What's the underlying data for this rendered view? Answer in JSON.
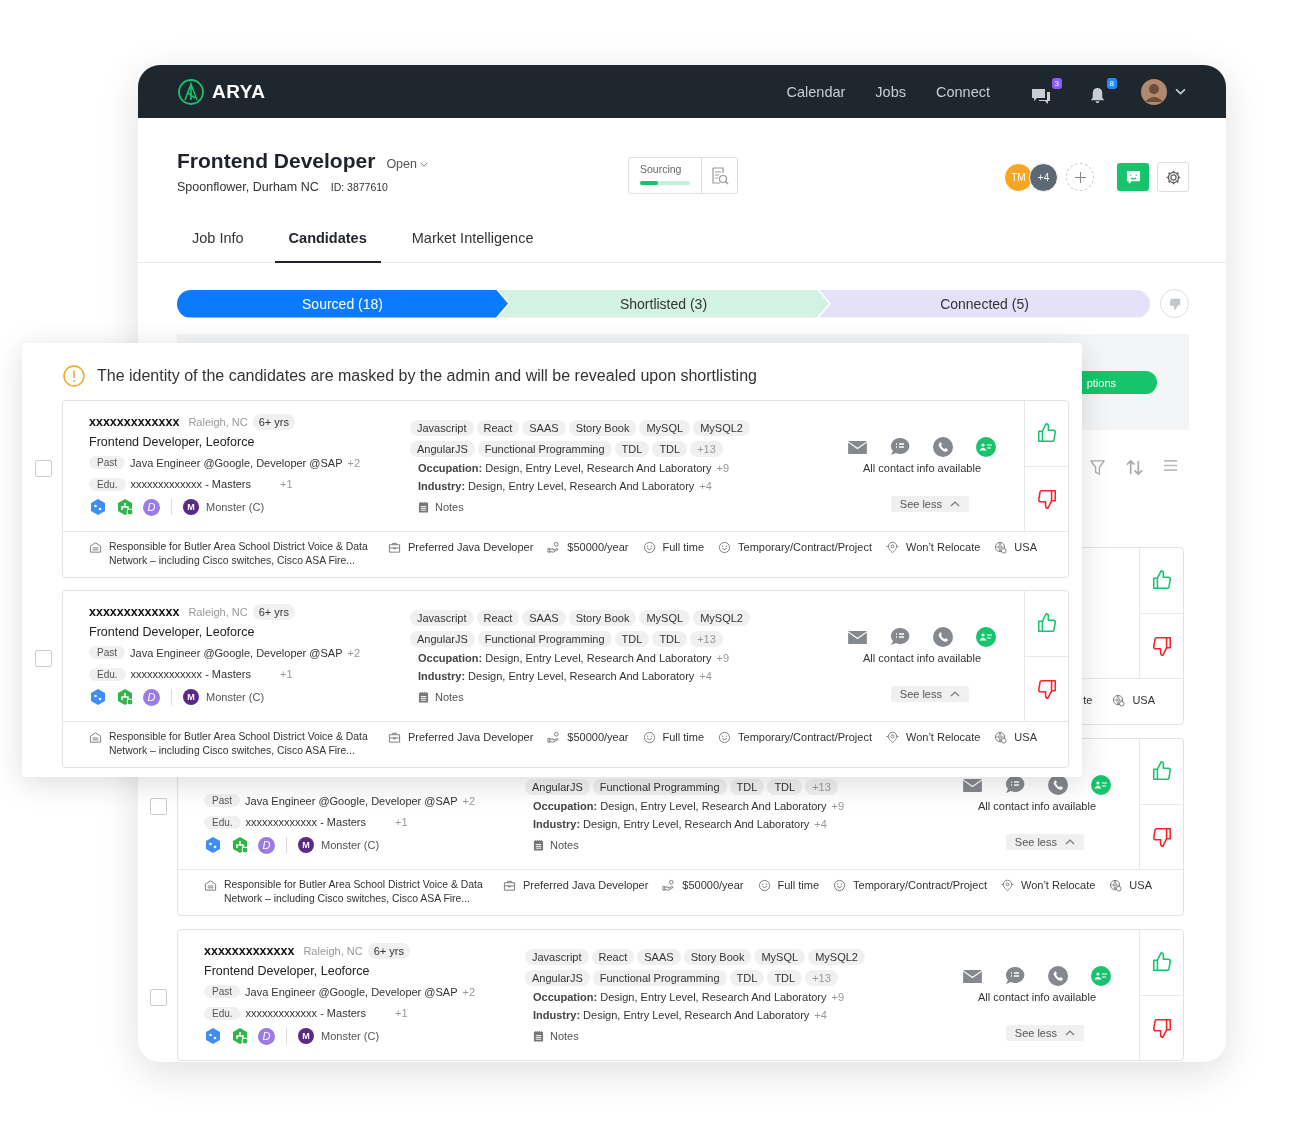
{
  "app": {
    "logo": "ARYA",
    "nav": [
      "Calendar",
      "Jobs",
      "Connect"
    ],
    "messages_badge": "3",
    "notifications_badge": "8"
  },
  "job": {
    "title": "Frontend Developer",
    "status": "Open",
    "location": "Spoonflower, Durham NC",
    "id_label": "ID: 3877610",
    "sourcing": {
      "label": "Sourcing",
      "level": 0.35
    },
    "team": [
      {
        "initials": "TM",
        "color": "#f6a623"
      },
      {
        "initials": "+4",
        "color": "#5d6875"
      }
    ]
  },
  "tabs": [
    {
      "label": "Job Info",
      "selected": false
    },
    {
      "label": "Candidates",
      "selected": true
    },
    {
      "label": "Market Intelligence",
      "selected": false
    }
  ],
  "pipeline": [
    {
      "label": "Sourced (18)",
      "selected": true,
      "color": "#0a7bff"
    },
    {
      "label": "Shortlisted (3)",
      "selected": false,
      "color": "#d2f2e3"
    },
    {
      "label": "Connected (5)",
      "selected": false,
      "color": "#e4e1f8"
    }
  ],
  "options_button": "ptions",
  "background_cards": [
    {
      "kind": "edge",
      "footer": [
        {
          "kind": "cut",
          "text": "te"
        },
        {
          "kind": "country",
          "text": "USA"
        }
      ]
    },
    {
      "kind": "full",
      "checked": false,
      "past": {
        "label": "Past",
        "text": "Java Engineer @Google, Developer @SAP",
        "more": "+2"
      },
      "edu": {
        "label": "Edu.",
        "text": "xxxxxxxxxxxxx - Masters",
        "more": "+1"
      },
      "badge": "D",
      "source": {
        "letter": "M",
        "name": "Monster (C)"
      },
      "skills_row_2": {
        "chips": [
          "AngularJS",
          "Functional Programming",
          "TDL",
          "TDL"
        ],
        "more": "+13"
      },
      "occupation": {
        "label": "Occupation:",
        "text": "Design, Entry Level, Research And Laboratory",
        "more": "+9"
      },
      "industry": {
        "label": "Industry:",
        "text": "Design, Entry Level, Research And Laboratory",
        "more": "+4"
      },
      "notes": "Notes",
      "contact": "All contact info available",
      "see_less": "See less",
      "footer": [
        {
          "kind": "summary",
          "text": "Responsible for Butler Area School District Voice & Data Network – including Cisco switches, Cisco ASA Fire..."
        },
        {
          "kind": "job",
          "text": "Preferred Java Developer"
        },
        {
          "kind": "salary",
          "text": "$50000/year"
        },
        {
          "kind": "type",
          "text": "Full time"
        },
        {
          "kind": "type",
          "text": "Temporary/Contract/Project"
        },
        {
          "kind": "relocate",
          "text": "Won’t Relocate"
        },
        {
          "kind": "country",
          "text": "USA"
        }
      ]
    },
    {
      "kind": "full",
      "checked": false,
      "name": "xxxxxxxxxxxxx",
      "location": "Raleigh, NC",
      "experience": "6+ yrs",
      "title": "Frontend Developer, Leoforce",
      "past": {
        "label": "Past",
        "text": "Java Engineer @Google, Developer @SAP",
        "more": "+2"
      },
      "edu": {
        "label": "Edu.",
        "text": "xxxxxxxxxxxxx - Masters",
        "more": "+1"
      },
      "badge": "D",
      "source": {
        "letter": "M",
        "name": "Monster (C)"
      },
      "skills_row_1": {
        "chips": [
          "Javascript",
          "React",
          "SAAS",
          "Story Book",
          "MySQL",
          "MySQL2"
        ]
      },
      "skills_row_2": {
        "chips": [
          "AngularJS",
          "Functional Programming",
          "TDL",
          "TDL"
        ],
        "more": "+13"
      },
      "occupation": {
        "label": "Occupation:",
        "text": "Design, Entry Level, Research And Laboratory",
        "more": "+9"
      },
      "industry": {
        "label": "Industry:",
        "text": "Design, Entry Level, Research And Laboratory",
        "more": "+4"
      },
      "notes": "Notes",
      "contact": "All contact info available",
      "see_less": "See less"
    }
  ],
  "notice": "The identity of the candidates are masked by the admin and will be revealed upon shortlisting",
  "overlay_cards": [
    {
      "kind": "full",
      "checked": false,
      "name": "xxxxxxxxxxxxx",
      "location": "Raleigh, NC",
      "experience": "6+ yrs",
      "title": "Frontend Developer, Leoforce",
      "past": {
        "label": "Past",
        "text": "Java Engineer @Google, Developer @SAP",
        "more": "+2"
      },
      "edu": {
        "label": "Edu.",
        "text": "xxxxxxxxxxxxx - Masters",
        "more": "+1"
      },
      "badge": "D",
      "source": {
        "letter": "M",
        "name": "Monster (C)"
      },
      "skills_row_1": {
        "chips": [
          "Javascript",
          "React",
          "SAAS",
          "Story Book",
          "MySQL",
          "MySQL2"
        ]
      },
      "skills_row_2": {
        "chips": [
          "AngularJS",
          "Functional Programming",
          "TDL",
          "TDL"
        ],
        "more": "+13"
      },
      "occupation": {
        "label": "Occupation:",
        "text": "Design, Entry Level, Research And Laboratory",
        "more": "+9"
      },
      "industry": {
        "label": "Industry:",
        "text": "Design, Entry Level, Research And Laboratory",
        "more": "+4"
      },
      "notes": "Notes",
      "contact": "All contact info available",
      "see_less": "See less",
      "footer": [
        {
          "kind": "summary",
          "text": "Responsible for Butler Area School District Voice & Data Network – including Cisco switches, Cisco ASA Fire..."
        },
        {
          "kind": "job",
          "text": "Preferred Java Developer"
        },
        {
          "kind": "salary",
          "text": "$50000/year"
        },
        {
          "kind": "type",
          "text": "Full time"
        },
        {
          "kind": "type",
          "text": "Temporary/Contract/Project"
        },
        {
          "kind": "relocate",
          "text": "Won’t Relocate"
        },
        {
          "kind": "country",
          "text": "USA"
        }
      ]
    },
    {
      "kind": "full",
      "checked": false,
      "name": "xxxxxxxxxxxxx",
      "location": "Raleigh, NC",
      "experience": "6+ yrs",
      "title": "Frontend Developer, Leoforce",
      "past": {
        "label": "Past",
        "text": "Java Engineer @Google, Developer @SAP",
        "more": "+2"
      },
      "edu": {
        "label": "Edu.",
        "text": "xxxxxxxxxxxxx - Masters",
        "more": "+1"
      },
      "badge": "D",
      "source": {
        "letter": "M",
        "name": "Monster (C)"
      },
      "skills_row_1": {
        "chips": [
          "Javascript",
          "React",
          "SAAS",
          "Story Book",
          "MySQL",
          "MySQL2"
        ]
      },
      "skills_row_2": {
        "chips": [
          "AngularJS",
          "Functional Programming",
          "TDL",
          "TDL"
        ],
        "more": "+13"
      },
      "occupation": {
        "label": "Occupation:",
        "text": "Design, Entry Level, Research And Laboratory",
        "more": "+9"
      },
      "industry": {
        "label": "Industry:",
        "text": "Design, Entry Level, Research And Laboratory",
        "more": "+4"
      },
      "notes": "Notes",
      "contact": "All contact info available",
      "see_less": "See less",
      "footer": [
        {
          "kind": "summary",
          "text": "Responsible for Butler Area School District Voice & Data Network – including Cisco switches, Cisco ASA Fire..."
        },
        {
          "kind": "job",
          "text": "Preferred Java Developer"
        },
        {
          "kind": "salary",
          "text": "$50000/year"
        },
        {
          "kind": "type",
          "text": "Full time"
        },
        {
          "kind": "type",
          "text": "Temporary/Contract/Project"
        },
        {
          "kind": "relocate",
          "text": "Won’t Relocate"
        },
        {
          "kind": "country",
          "text": "USA"
        }
      ]
    }
  ]
}
